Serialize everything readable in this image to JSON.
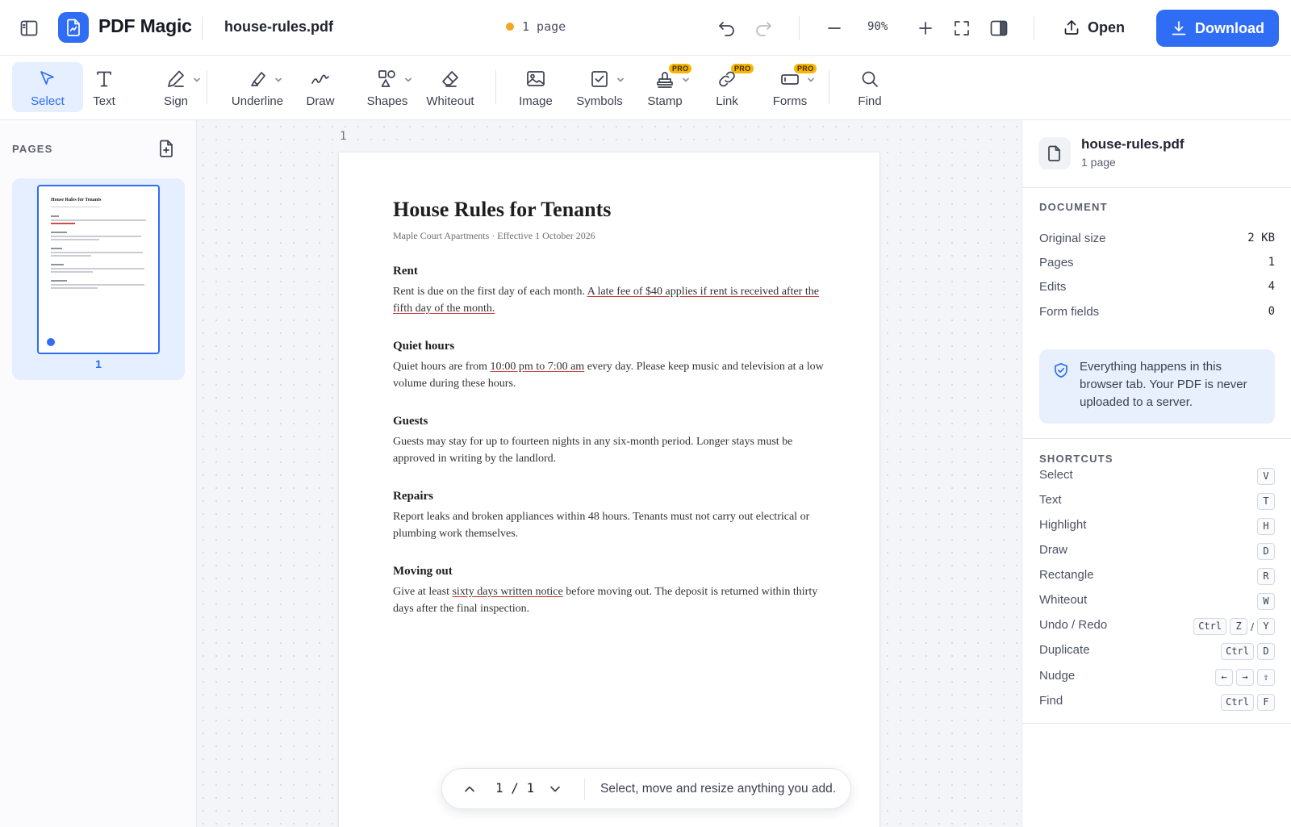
{
  "header": {
    "app_name": "PDF Magic",
    "file_name": "house-rules.pdf",
    "page_status": "1 page",
    "zoom": "90%",
    "open_label": "Open",
    "download_label": "Download",
    "accent_color": "#2f6df5",
    "icons": [
      "sidebar-toggle-icon",
      "logo-icon",
      "undo-icon",
      "redo-icon",
      "zoom-out-icon",
      "zoom-in-icon",
      "fullscreen-icon",
      "panel-icon",
      "upload-icon",
      "download-icon"
    ]
  },
  "toolbar": {
    "active": "Select",
    "tools": [
      {
        "label": "Select",
        "icon": "cursor-icon"
      },
      {
        "label": "Text",
        "icon": "text-icon"
      },
      {
        "label": "Sign",
        "icon": "pen-icon",
        "dropdown": true
      },
      {
        "label": "Underline",
        "icon": "highlighter-icon",
        "dropdown": true
      },
      {
        "label": "Draw",
        "icon": "squiggle-icon"
      },
      {
        "label": "Shapes",
        "icon": "shapes-icon",
        "dropdown": true
      },
      {
        "label": "Whiteout",
        "icon": "eraser-icon"
      },
      {
        "label": "Image",
        "icon": "image-icon"
      },
      {
        "label": "Symbols",
        "icon": "checkbox-icon",
        "dropdown": true
      },
      {
        "label": "Stamp",
        "icon": "stamp-icon",
        "badge": "PRO",
        "dropdown": true
      },
      {
        "label": "Link",
        "icon": "link-icon",
        "badge": "PRO"
      },
      {
        "label": "Forms",
        "icon": "form-icon",
        "badge": "PRO",
        "dropdown": true
      },
      {
        "label": "Find",
        "icon": "search-icon"
      }
    ]
  },
  "pages_panel": {
    "title": "PAGES",
    "thumbnails": [
      {
        "number": "1",
        "title": "House Rules for Tenants"
      }
    ]
  },
  "canvas": {
    "page_label": "1"
  },
  "document": {
    "title": "House Rules for Tenants",
    "subtitle": "Maple Court Apartments  ·  Effective 1 October 2026",
    "sections": [
      {
        "heading": "Rent",
        "pre": "Rent is due on the first day of each month. ",
        "underlined": "A late fee of $40 applies if rent is received after the fifth day of the month.",
        "post": ""
      },
      {
        "heading": "Quiet hours",
        "pre": "Quiet hours are from ",
        "underlined": "10:00 pm to 7:00 am",
        "post": " every day. Please keep music and television at a low volume during these hours."
      },
      {
        "heading": "Guests",
        "pre": "Guests may stay for up to fourteen nights in any six-month period. Longer stays must be approved in writing by the landlord.",
        "underlined": "",
        "post": ""
      },
      {
        "heading": "Repairs",
        "pre": "Report leaks and broken appliances within 48 hours. Tenants must not carry out electrical or plumbing work themselves.",
        "underlined": "",
        "post": ""
      },
      {
        "heading": "Moving out",
        "pre": "Give at least ",
        "underlined": "sixty days written notice",
        "post": " before moving out. The deposit is returned within thirty days after the final inspection."
      }
    ]
  },
  "page_nav": {
    "count": "1 / 1",
    "hint": "Select, move and resize anything you add."
  },
  "info_panel": {
    "file_name": "house-rules.pdf",
    "pages_text": "1 page",
    "document_label": "DOCUMENT",
    "stats": [
      {
        "label": "Original size",
        "value": "2 KB"
      },
      {
        "label": "Pages",
        "value": "1"
      },
      {
        "label": "Edits",
        "value": "4"
      },
      {
        "label": "Form fields",
        "value": "0"
      }
    ],
    "privacy_note": "Everything happens in this browser tab. Your PDF is never uploaded to a server.",
    "shortcuts_label": "SHORTCUTS",
    "shortcuts": [
      {
        "label": "Select",
        "keys": [
          "V"
        ]
      },
      {
        "label": "Text",
        "keys": [
          "T"
        ]
      },
      {
        "label": "Highlight",
        "keys": [
          "H"
        ]
      },
      {
        "label": "Draw",
        "keys": [
          "D"
        ]
      },
      {
        "label": "Rectangle",
        "keys": [
          "R"
        ]
      },
      {
        "label": "Whiteout",
        "keys": [
          "W"
        ]
      },
      {
        "label": "Undo / Redo",
        "keys": [
          "Ctrl",
          "Z",
          "/",
          "Y"
        ]
      },
      {
        "label": "Duplicate",
        "keys": [
          "Ctrl",
          "D"
        ]
      },
      {
        "label": "Nudge",
        "keys": [
          "←",
          "→",
          "⇧"
        ]
      },
      {
        "label": "Find",
        "keys": [
          "Ctrl",
          "F"
        ]
      }
    ]
  }
}
